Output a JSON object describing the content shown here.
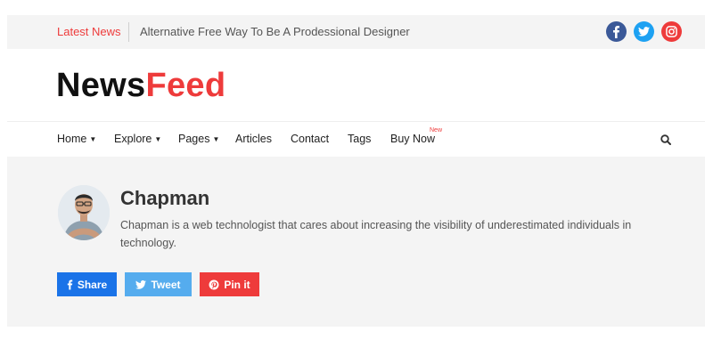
{
  "topbar": {
    "latest_label": "Latest News",
    "headline": "Alternative Free Way To Be A Prodessional Designer",
    "social": [
      {
        "name": "facebook",
        "icon": "facebook-icon",
        "color": "#3b5998"
      },
      {
        "name": "twitter",
        "icon": "twitter-icon",
        "color": "#1da1f2"
      },
      {
        "name": "instagram",
        "icon": "instagram-icon",
        "color": "#ee3b3b"
      }
    ]
  },
  "logo": {
    "part1": "News",
    "part2": "Feed",
    "accent_color": "#ee3b3b"
  },
  "nav": {
    "items": [
      {
        "label": "Home",
        "dropdown": true
      },
      {
        "label": "Explore",
        "dropdown": true
      },
      {
        "label": "Pages",
        "dropdown": true
      },
      {
        "label": "Articles",
        "dropdown": false
      },
      {
        "label": "Contact",
        "dropdown": false
      },
      {
        "label": "Tags",
        "dropdown": false
      },
      {
        "label": "Buy Now",
        "dropdown": false,
        "badge": "New"
      }
    ],
    "search_icon": "search-icon"
  },
  "author": {
    "name": "Chapman",
    "bio": "Chapman is a web technologist that cares about increasing the visibility of underestimated individuals in technology."
  },
  "share": {
    "facebook_label": "Share",
    "twitter_label": "Tweet",
    "pinterest_label": "Pin it",
    "colors": {
      "facebook": "#1a73e8",
      "twitter": "#55acee",
      "pinterest": "#ee3b3b"
    }
  }
}
